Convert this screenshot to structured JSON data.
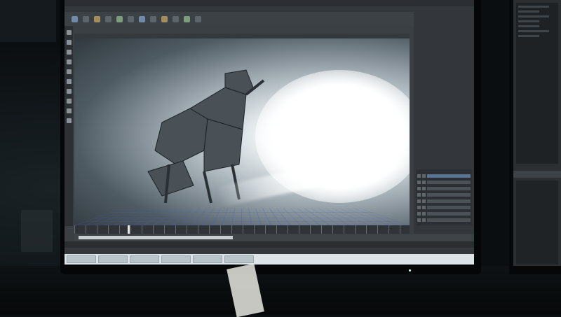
{
  "scene": {
    "colors": {
      "screen_ui": "#3a3f43",
      "viewport_glow": "#ffffff",
      "grid": "#4658c8",
      "room": "#0c1012"
    }
  },
  "maya": {
    "menus": [],
    "shelf_tabs": [],
    "viewport_menu": [],
    "layer_tabs": [],
    "layers": []
  }
}
